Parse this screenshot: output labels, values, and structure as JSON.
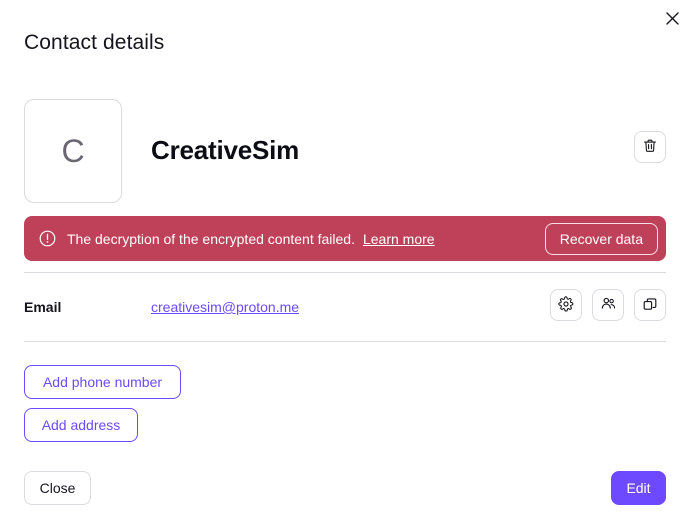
{
  "modal": {
    "title": "Contact details",
    "close_icon": "close-icon"
  },
  "contact": {
    "avatar_initial": "C",
    "name": "CreativeSim",
    "delete_icon": "trash-icon"
  },
  "error_banner": {
    "icon": "exclamation-circle-icon",
    "message": "The decryption of the encrypted content failed.",
    "link_label": "Learn more",
    "action_label": "Recover data",
    "background_color": "#bf4059",
    "text_color": "#ffffff"
  },
  "fields": [
    {
      "label": "Email",
      "value": "creativesim@proton.me",
      "actions": [
        {
          "name": "settings-icon",
          "title": "gear-icon"
        },
        {
          "name": "group-icon",
          "title": "users-icon"
        },
        {
          "name": "copy-icon",
          "title": "copy-icon"
        }
      ]
    }
  ],
  "add_actions": {
    "phone_label": "Add phone number",
    "address_label": "Add address"
  },
  "footer": {
    "close_label": "Close",
    "edit_label": "Edit"
  },
  "colors": {
    "accent": "#6d4aff",
    "danger": "#bf4059",
    "border": "#dcdadf",
    "text": "#16141c"
  }
}
